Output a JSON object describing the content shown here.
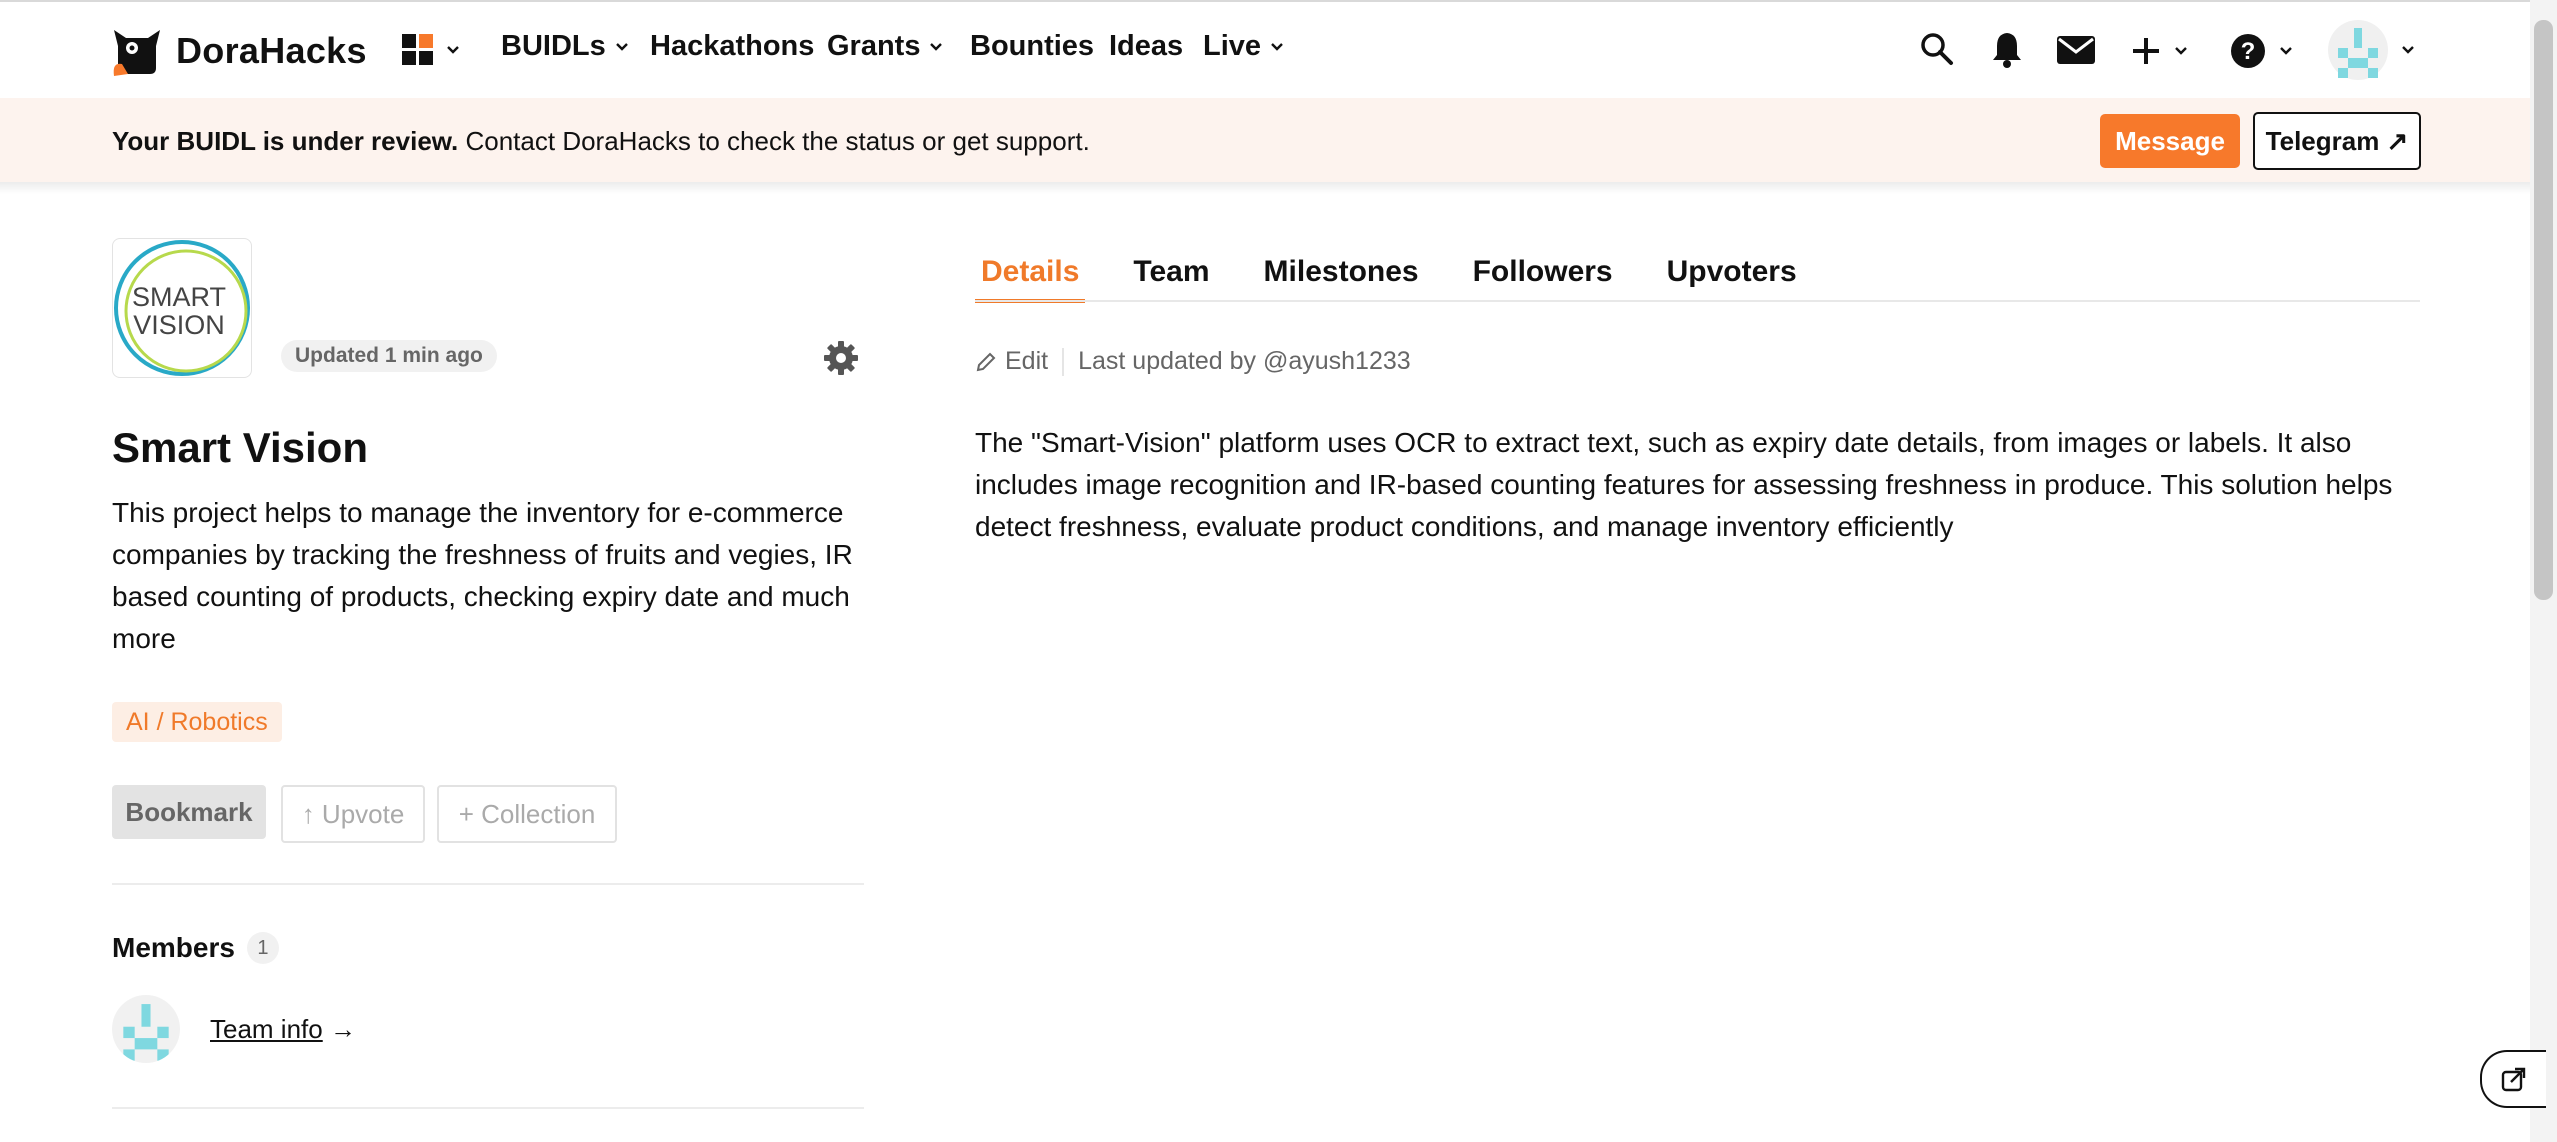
{
  "nav": {
    "brand": "DoraHacks",
    "menu": [
      {
        "label": "BUIDLs"
      },
      {
        "label": "Hackathons"
      },
      {
        "label": "Grants"
      },
      {
        "label": "Bounties"
      },
      {
        "label": "Ideas"
      },
      {
        "label": "Live"
      }
    ],
    "icons": [
      "grid-icon",
      "search-icon",
      "bell-icon",
      "mail-icon",
      "plus-icon",
      "help-icon",
      "avatar"
    ]
  },
  "banner": {
    "bold": "Your BUIDL is under review.",
    "text": " Contact DoraHacks to check the status or get support.",
    "message_btn": "Message",
    "telegram_btn": "Telegram ↗"
  },
  "project": {
    "logo_text_1": "SMART",
    "logo_text_2": "VISION",
    "updated": "Updated 1 min ago",
    "name": "Smart Vision",
    "description": "This project helps to manage the inventory for e-commerce companies by tracking the freshness of fruits and vegies, IR based counting of products, checking expiry date and much more",
    "tag": "AI / Robotics",
    "bookmark": "Bookmark",
    "upvote": "↑ Upvote",
    "collection": "+ Collection"
  },
  "members": {
    "title": "Members",
    "count": "1",
    "team_info": "Team info",
    "arrow": " →"
  },
  "tabs": [
    "Details",
    "Team",
    "Milestones",
    "Followers",
    "Upvoters"
  ],
  "details": {
    "edit": "Edit",
    "last_updated": "Last updated by @ayush1233",
    "body": "The \"Smart-Vision\" platform uses OCR to extract text, such as expiry date details, from images or labels. It also includes image recognition and IR-based counting features for assessing freshness in produce. This solution helps detect freshness, evaluate product conditions, and manage inventory efficiently"
  },
  "colors": {
    "accent": "#f7792b",
    "banner_bg": "#fdf3ee",
    "tag_bg": "#fdeee4",
    "avatar_teal": "#7fd8e0"
  }
}
